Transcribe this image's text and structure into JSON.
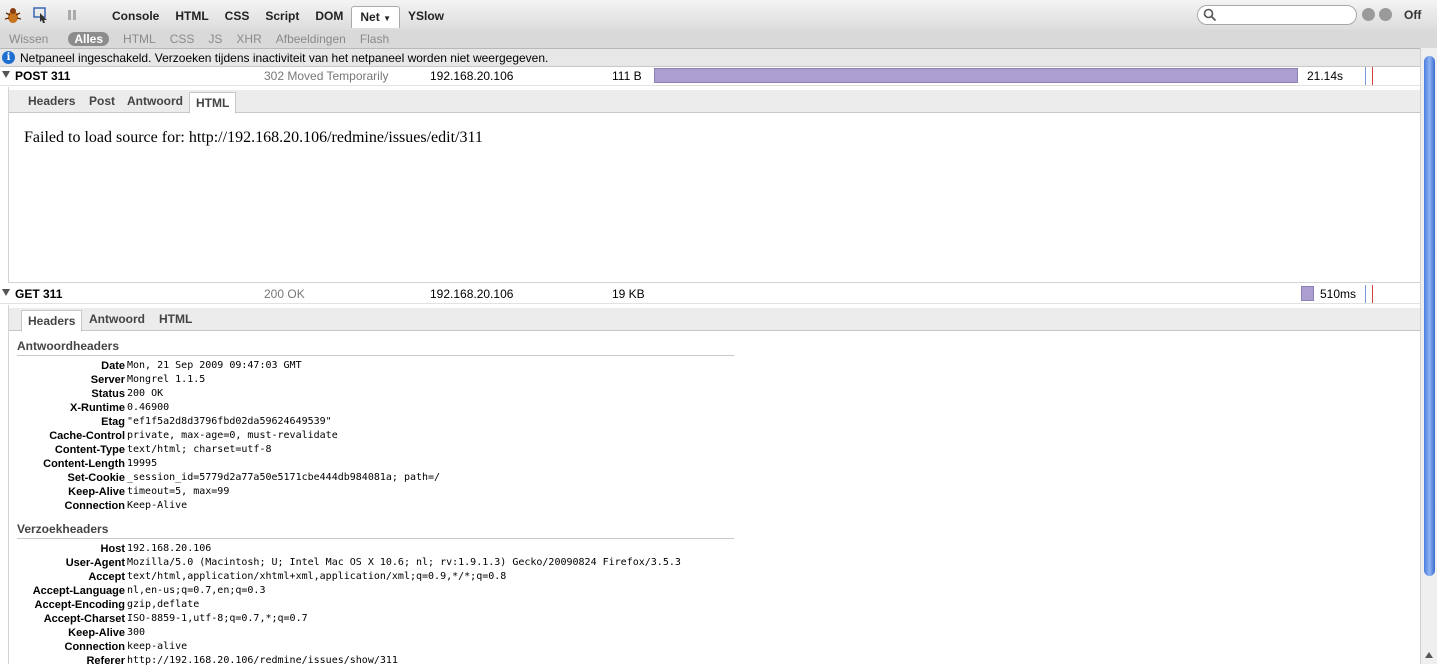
{
  "toolbar": {
    "tabs": [
      "Console",
      "HTML",
      "CSS",
      "Script",
      "DOM",
      "Net",
      "YSlow"
    ],
    "active_tab": "Net",
    "off_label": "Off"
  },
  "subbar": {
    "clear": "Wissen",
    "filters": [
      "Alles",
      "HTML",
      "CSS",
      "JS",
      "XHR",
      "Afbeeldingen",
      "Flash"
    ],
    "active_filter": "Alles"
  },
  "info": {
    "text": "Netpaneel ingeschakeld. Verzoeken tijdens inactiviteit van het netpaneel worden niet weergegeven."
  },
  "requests": [
    {
      "method_url": "POST 311",
      "status": "302 Moved Temporarily",
      "domain": "192.168.20.106",
      "size": "111 B",
      "time": "21.14s",
      "bar_fraction": 0.99
    },
    {
      "method_url": "GET 311",
      "status": "200 OK",
      "domain": "192.168.20.106",
      "size": "19 KB",
      "time": "510ms",
      "bar_fraction": 0.02
    }
  ],
  "post_detail": {
    "tabs": [
      "Headers",
      "Post",
      "Antwoord",
      "HTML"
    ],
    "active_tab": "HTML",
    "message": "Failed to load source for: http://192.168.20.106/redmine/issues/edit/311"
  },
  "get_detail": {
    "tabs": [
      "Headers",
      "Antwoord",
      "HTML"
    ],
    "active_tab": "Headers",
    "response_title": "Antwoordheaders",
    "response_headers": [
      {
        "name": "Date",
        "value": "Mon, 21 Sep 2009 09:47:03 GMT"
      },
      {
        "name": "Server",
        "value": "Mongrel 1.1.5"
      },
      {
        "name": "Status",
        "value": "200 OK"
      },
      {
        "name": "X-Runtime",
        "value": "0.46900"
      },
      {
        "name": "Etag",
        "value": "\"ef1f5a2d8d3796fbd02da59624649539\""
      },
      {
        "name": "Cache-Control",
        "value": "private, max-age=0, must-revalidate"
      },
      {
        "name": "Content-Type",
        "value": "text/html; charset=utf-8"
      },
      {
        "name": "Content-Length",
        "value": "19995"
      },
      {
        "name": "Set-Cookie",
        "value": "_session_id=5779d2a77a50e5171cbe444db984081a; path=/"
      },
      {
        "name": "Keep-Alive",
        "value": "timeout=5, max=99"
      },
      {
        "name": "Connection",
        "value": "Keep-Alive"
      }
    ],
    "request_title": "Verzoekheaders",
    "request_headers": [
      {
        "name": "Host",
        "value": "192.168.20.106"
      },
      {
        "name": "User-Agent",
        "value": "Mozilla/5.0 (Macintosh; U; Intel Mac OS X 10.6; nl; rv:1.9.1.3) Gecko/20090824 Firefox/3.5.3"
      },
      {
        "name": "Accept",
        "value": "text/html,application/xhtml+xml,application/xml;q=0.9,*/*;q=0.8"
      },
      {
        "name": "Accept-Language",
        "value": "nl,en-us;q=0.7,en;q=0.3"
      },
      {
        "name": "Accept-Encoding",
        "value": "gzip,deflate"
      },
      {
        "name": "Accept-Charset",
        "value": "ISO-8859-1,utf-8;q=0.7,*;q=0.7"
      },
      {
        "name": "Keep-Alive",
        "value": "300"
      },
      {
        "name": "Connection",
        "value": "keep-alive"
      },
      {
        "name": "Referer",
        "value": "http://192.168.20.106/redmine/issues/show/311"
      }
    ]
  },
  "colors": {
    "timeline_bar": "#ab9fcf",
    "info_icon": "#1f6fd1",
    "scroll_thumb": "#4a7ede"
  }
}
